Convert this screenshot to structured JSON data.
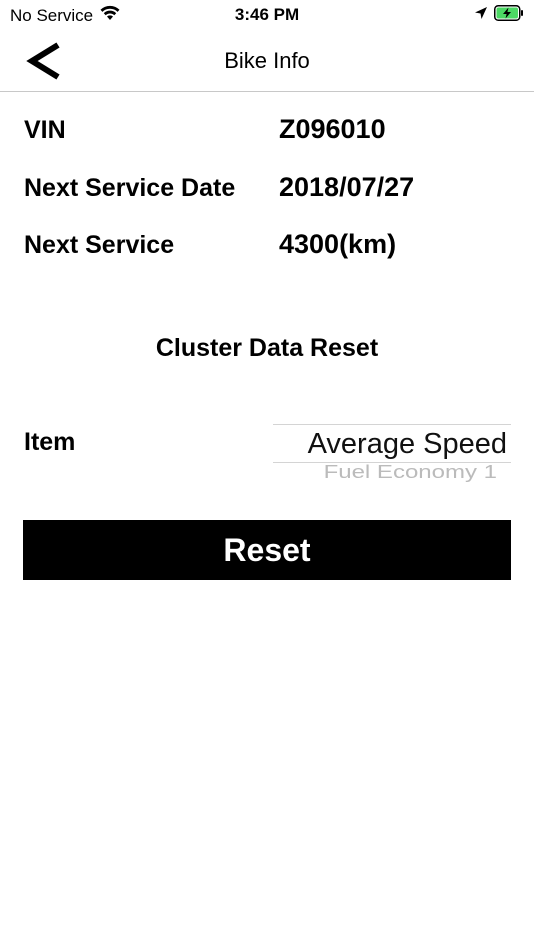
{
  "status_bar": {
    "carrier": "No Service",
    "time": "3:46 PM"
  },
  "nav": {
    "title": "Bike Info"
  },
  "info": [
    {
      "label": "VIN",
      "value": "Z096010"
    },
    {
      "label": "Next Service Date",
      "value": "2018/07/27"
    },
    {
      "label": "Next Service",
      "value": "4300(km)"
    }
  ],
  "cluster": {
    "title": "Cluster Data Reset",
    "item_label": "Item",
    "picker_selected": "Average Speed",
    "picker_next": "Fuel Economy 1",
    "reset_label": "Reset"
  },
  "colors": {
    "button_bg": "#000000",
    "button_text": "#ffffff",
    "battery_fill": "#4cd964"
  },
  "icons": [
    "wifi-icon",
    "location-arrow-icon",
    "battery-charging-icon",
    "chevron-left-icon"
  ]
}
